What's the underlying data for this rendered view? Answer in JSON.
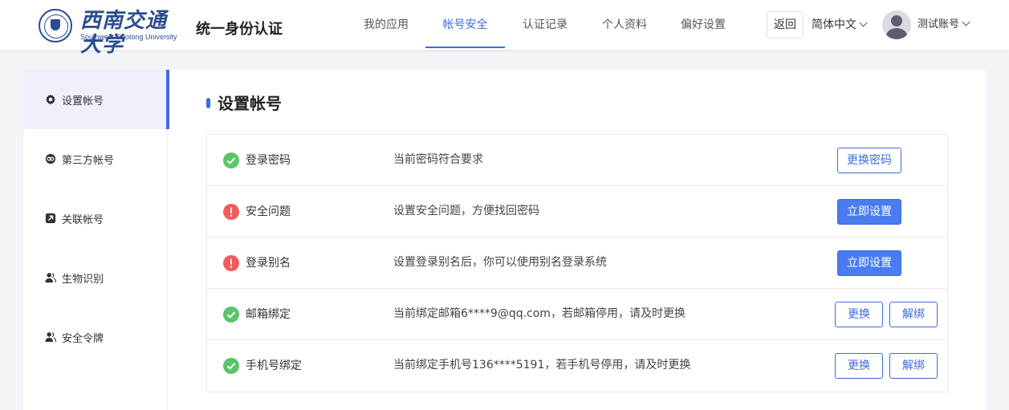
{
  "header": {
    "logo": {
      "cn": "西南交通大学",
      "en": "Southwest Jiaotong University"
    },
    "app_title": "统一身份认证",
    "nav": [
      {
        "label": "我的应用",
        "active": false
      },
      {
        "label": "帐号安全",
        "active": true
      },
      {
        "label": "认证记录",
        "active": false
      },
      {
        "label": "个人资料",
        "active": false
      },
      {
        "label": "偏好设置",
        "active": false
      }
    ],
    "back_label": "返回",
    "language": "简体中文",
    "username": "测试账号"
  },
  "sidebar": {
    "items": [
      {
        "label": "设置帐号",
        "icon": "gear-icon",
        "active": true
      },
      {
        "label": "第三方帐号",
        "icon": "link-icon",
        "active": false
      },
      {
        "label": "关联帐号",
        "icon": "related-account-icon",
        "active": false
      },
      {
        "label": "生物识别",
        "icon": "user-icon",
        "active": false
      },
      {
        "label": "安全令牌",
        "icon": "user-icon",
        "active": false
      }
    ]
  },
  "main": {
    "title": "设置帐号",
    "rows": [
      {
        "status": "ok",
        "label": "登录密码",
        "desc": "当前密码符合要求",
        "buttons": [
          {
            "label": "更换密码",
            "style": "outline"
          }
        ]
      },
      {
        "status": "warn",
        "label": "安全问题",
        "desc": "设置安全问题，方便找回密码",
        "buttons": [
          {
            "label": "立即设置",
            "style": "primary"
          }
        ]
      },
      {
        "status": "warn",
        "label": "登录别名",
        "desc": "设置登录别名后，你可以使用别名登录系统",
        "buttons": [
          {
            "label": "立即设置",
            "style": "primary"
          }
        ]
      },
      {
        "status": "ok",
        "label": "邮箱绑定",
        "desc": "当前绑定邮箱6****9@qq.com，若邮箱停用，请及时更换",
        "buttons": [
          {
            "label": "更换",
            "style": "outline"
          },
          {
            "label": "解绑",
            "style": "outline"
          }
        ]
      },
      {
        "status": "ok",
        "label": "手机号绑定",
        "desc": "当前绑定手机号136****5191，若手机号停用，请及时更换",
        "buttons": [
          {
            "label": "更换",
            "style": "outline"
          },
          {
            "label": "解绑",
            "style": "outline"
          }
        ]
      }
    ]
  },
  "colors": {
    "accent": "#3c6cde",
    "primary_button": "#4a7bef",
    "ok": "#5cc46a",
    "warn": "#f25b5b"
  }
}
